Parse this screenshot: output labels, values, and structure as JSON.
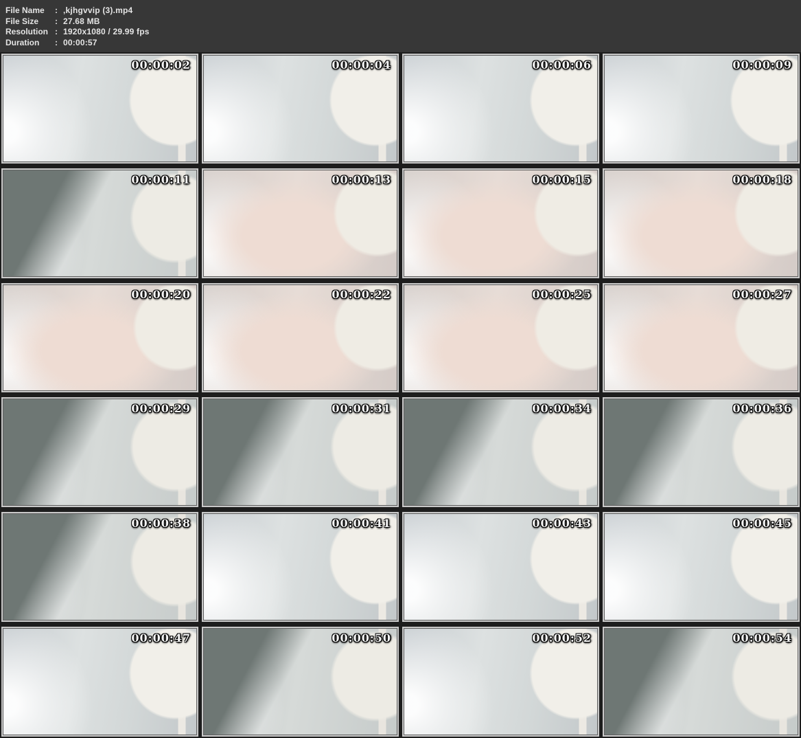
{
  "colors": {
    "page_bg": "#1d1d1d",
    "header_bg": "#373737",
    "header_text": "#e4e4e4",
    "frame_border": "#c9c9c9",
    "timestamp_color": "#f5f5f5"
  },
  "metadata": {
    "separator": ":",
    "rows": [
      {
        "label": "File Name",
        "value": ",kjhgvvip (3).mp4"
      },
      {
        "label": "File Size",
        "value": "27.68 MB"
      },
      {
        "label": "Resolution",
        "value": "1920x1080 / 29.99 fps"
      },
      {
        "label": "Duration",
        "value": "00:00:57"
      }
    ]
  },
  "thumbnails": [
    {
      "time": "00:00:02",
      "tone": "light"
    },
    {
      "time": "00:00:04",
      "tone": "light"
    },
    {
      "time": "00:00:06",
      "tone": "light"
    },
    {
      "time": "00:00:09",
      "tone": "light"
    },
    {
      "time": "00:00:11",
      "tone": "dark"
    },
    {
      "time": "00:00:13",
      "tone": "pale"
    },
    {
      "time": "00:00:15",
      "tone": "pale"
    },
    {
      "time": "00:00:18",
      "tone": "pale"
    },
    {
      "time": "00:00:20",
      "tone": "pale"
    },
    {
      "time": "00:00:22",
      "tone": "pale"
    },
    {
      "time": "00:00:25",
      "tone": "pale"
    },
    {
      "time": "00:00:27",
      "tone": "pale"
    },
    {
      "time": "00:00:29",
      "tone": "dark"
    },
    {
      "time": "00:00:31",
      "tone": "dark"
    },
    {
      "time": "00:00:34",
      "tone": "dark"
    },
    {
      "time": "00:00:36",
      "tone": "dark"
    },
    {
      "time": "00:00:38",
      "tone": "dark"
    },
    {
      "time": "00:00:41",
      "tone": "light"
    },
    {
      "time": "00:00:43",
      "tone": "light"
    },
    {
      "time": "00:00:45",
      "tone": "light"
    },
    {
      "time": "00:00:47",
      "tone": "light"
    },
    {
      "time": "00:00:50",
      "tone": "dark"
    },
    {
      "time": "00:00:52",
      "tone": "light"
    },
    {
      "time": "00:00:54",
      "tone": "dark"
    }
  ]
}
